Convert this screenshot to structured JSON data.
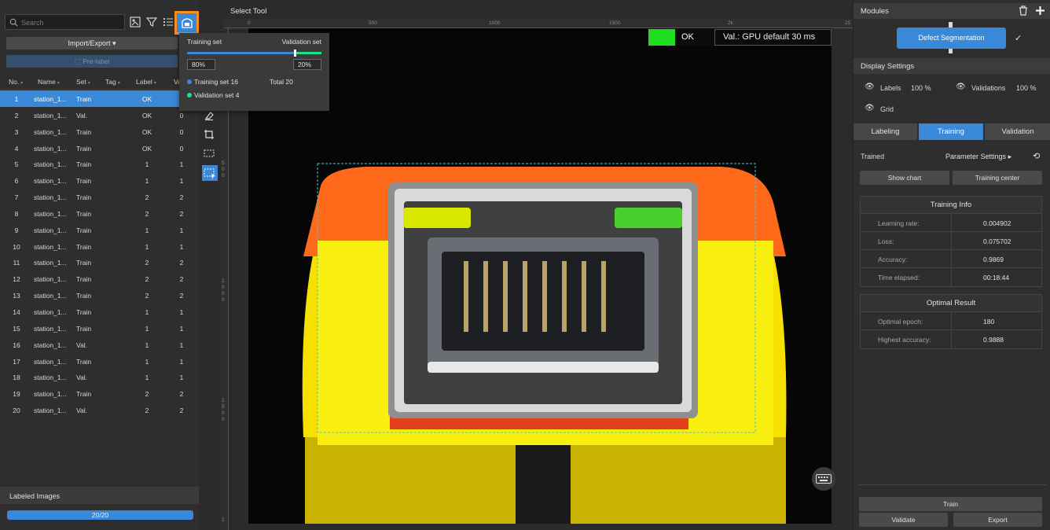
{
  "left": {
    "search_placeholder": "Search",
    "import_export_label": "Import/Export",
    "prelabel_label": "Pre-label",
    "columns": [
      "No.",
      "Name",
      "Set",
      "Tag",
      "Label",
      "Va"
    ],
    "rows": [
      {
        "no": "1",
        "name": "station_1...",
        "set": "Train",
        "label": "OK",
        "va": ""
      },
      {
        "no": "2",
        "name": "station_1...",
        "set": "Val.",
        "label": "OK",
        "va": "0"
      },
      {
        "no": "3",
        "name": "station_1...",
        "set": "Train",
        "label": "OK",
        "va": "0"
      },
      {
        "no": "4",
        "name": "station_1...",
        "set": "Train",
        "label": "OK",
        "va": "0"
      },
      {
        "no": "5",
        "name": "station_1...",
        "set": "Train",
        "label": "1",
        "va": "1"
      },
      {
        "no": "6",
        "name": "station_1...",
        "set": "Train",
        "label": "1",
        "va": "1"
      },
      {
        "no": "7",
        "name": "station_1...",
        "set": "Train",
        "label": "2",
        "va": "2"
      },
      {
        "no": "8",
        "name": "station_1...",
        "set": "Train",
        "label": "2",
        "va": "2"
      },
      {
        "no": "9",
        "name": "station_1...",
        "set": "Train",
        "label": "1",
        "va": "1"
      },
      {
        "no": "10",
        "name": "station_1...",
        "set": "Train",
        "label": "1",
        "va": "1"
      },
      {
        "no": "11",
        "name": "station_1...",
        "set": "Train",
        "label": "2",
        "va": "2"
      },
      {
        "no": "12",
        "name": "station_1...",
        "set": "Train",
        "label": "2",
        "va": "2"
      },
      {
        "no": "13",
        "name": "station_1...",
        "set": "Train",
        "label": "2",
        "va": "2"
      },
      {
        "no": "14",
        "name": "station_1...",
        "set": "Train",
        "label": "1",
        "va": "1"
      },
      {
        "no": "15",
        "name": "station_1...",
        "set": "Train",
        "label": "1",
        "va": "1"
      },
      {
        "no": "16",
        "name": "station_1...",
        "set": "Val.",
        "label": "1",
        "va": "1"
      },
      {
        "no": "17",
        "name": "station_1...",
        "set": "Train",
        "label": "1",
        "va": "1"
      },
      {
        "no": "18",
        "name": "station_1...",
        "set": "Val.",
        "label": "1",
        "va": "1"
      },
      {
        "no": "19",
        "name": "station_1...",
        "set": "Train",
        "label": "2",
        "va": "2"
      },
      {
        "no": "20",
        "name": "station_1...",
        "set": "Val.",
        "label": "2",
        "va": "2"
      }
    ],
    "labeled_images_title": "Labeled Images",
    "progress_text": "20/20",
    "progress_fraction": 1.0
  },
  "center": {
    "select_tool_label": "Select Tool",
    "ruler_top": [
      "0",
      "500",
      "1000",
      "1500",
      "2k",
      "25"
    ],
    "ruler_left": [
      "5\n0\n0",
      "1\n0\n0\n0",
      "1\n5\n0\n0",
      "2"
    ],
    "status_ok": "OK",
    "status_val": "Val.:  GPU default 30 ms",
    "status_color": "#1ee01e"
  },
  "popup": {
    "training_set_label": "Training set",
    "validation_set_label": "Validation set",
    "training_pct": "80%",
    "validation_pct": "20%",
    "split_fraction": 0.8,
    "training_count_label": "Training set",
    "training_count": "16",
    "total_label": "Total",
    "total_value": "20",
    "validation_count_label": "Validation set",
    "validation_count": "4"
  },
  "right": {
    "modules_title": "Modules",
    "module_name": "Defect Segmentation",
    "display_settings_title": "Display Settings",
    "labels_label": "Labels",
    "labels_value": "100 %",
    "validations_label": "Validations",
    "validations_value": "100 %",
    "grid_label": "Grid",
    "tabs": [
      "Labeling",
      "Training",
      "Validation"
    ],
    "trained_label": "Trained",
    "parameter_settings_label": "Parameter Settings",
    "show_chart_label": "Show chart",
    "training_center_label": "Training center",
    "training_info": {
      "title": "Training Info",
      "rows": [
        {
          "key": "Learning rate:",
          "value": "0.004902"
        },
        {
          "key": "Loss:",
          "value": "0.075702"
        },
        {
          "key": "Accuracy:",
          "value": "0.9869"
        },
        {
          "key": "Time elapsed:",
          "value": "00:18:44"
        }
      ]
    },
    "optimal_result": {
      "title": "Optimal Result",
      "rows": [
        {
          "key": "Optimal epoch:",
          "value": "180"
        },
        {
          "key": "Highest accuracy:",
          "value": "0.9888"
        }
      ]
    },
    "train_label": "Train",
    "validate_label": "Validate",
    "export_label": "Export"
  },
  "colors": {
    "accent": "#3a88d8",
    "highlight": "#ff8c1a",
    "validation_dot": "#1ee08a"
  }
}
